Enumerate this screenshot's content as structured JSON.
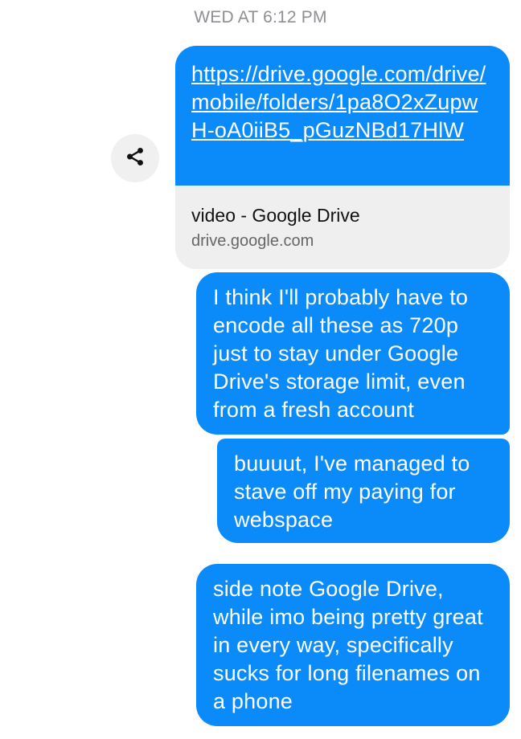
{
  "timestamp": "WED AT 6:12 PM",
  "share": {
    "icon": "share-icon"
  },
  "link_preview": {
    "url": "https://drive.google.com/drive/mobile/folders/1pa8O2xZupwH-oA0iiB5_pGuzNBd17HlW",
    "title": "video - Google Drive",
    "domain": "drive.google.com"
  },
  "messages": [
    {
      "text": "I think I'll probably have to encode all these as 720p just to stay under Google Drive's storage limit, even from a fresh account"
    },
    {
      "text": "buuuut, I've managed to stave off my paying for webspace"
    },
    {
      "text": "side note Google Drive, while imo being pretty great in every way, specifically sucks for long filenames on a phone"
    }
  ],
  "colors": {
    "sent_bubble": "#0b8bfa",
    "preview_bg": "#efefef",
    "timestamp": "#8e8e93"
  }
}
